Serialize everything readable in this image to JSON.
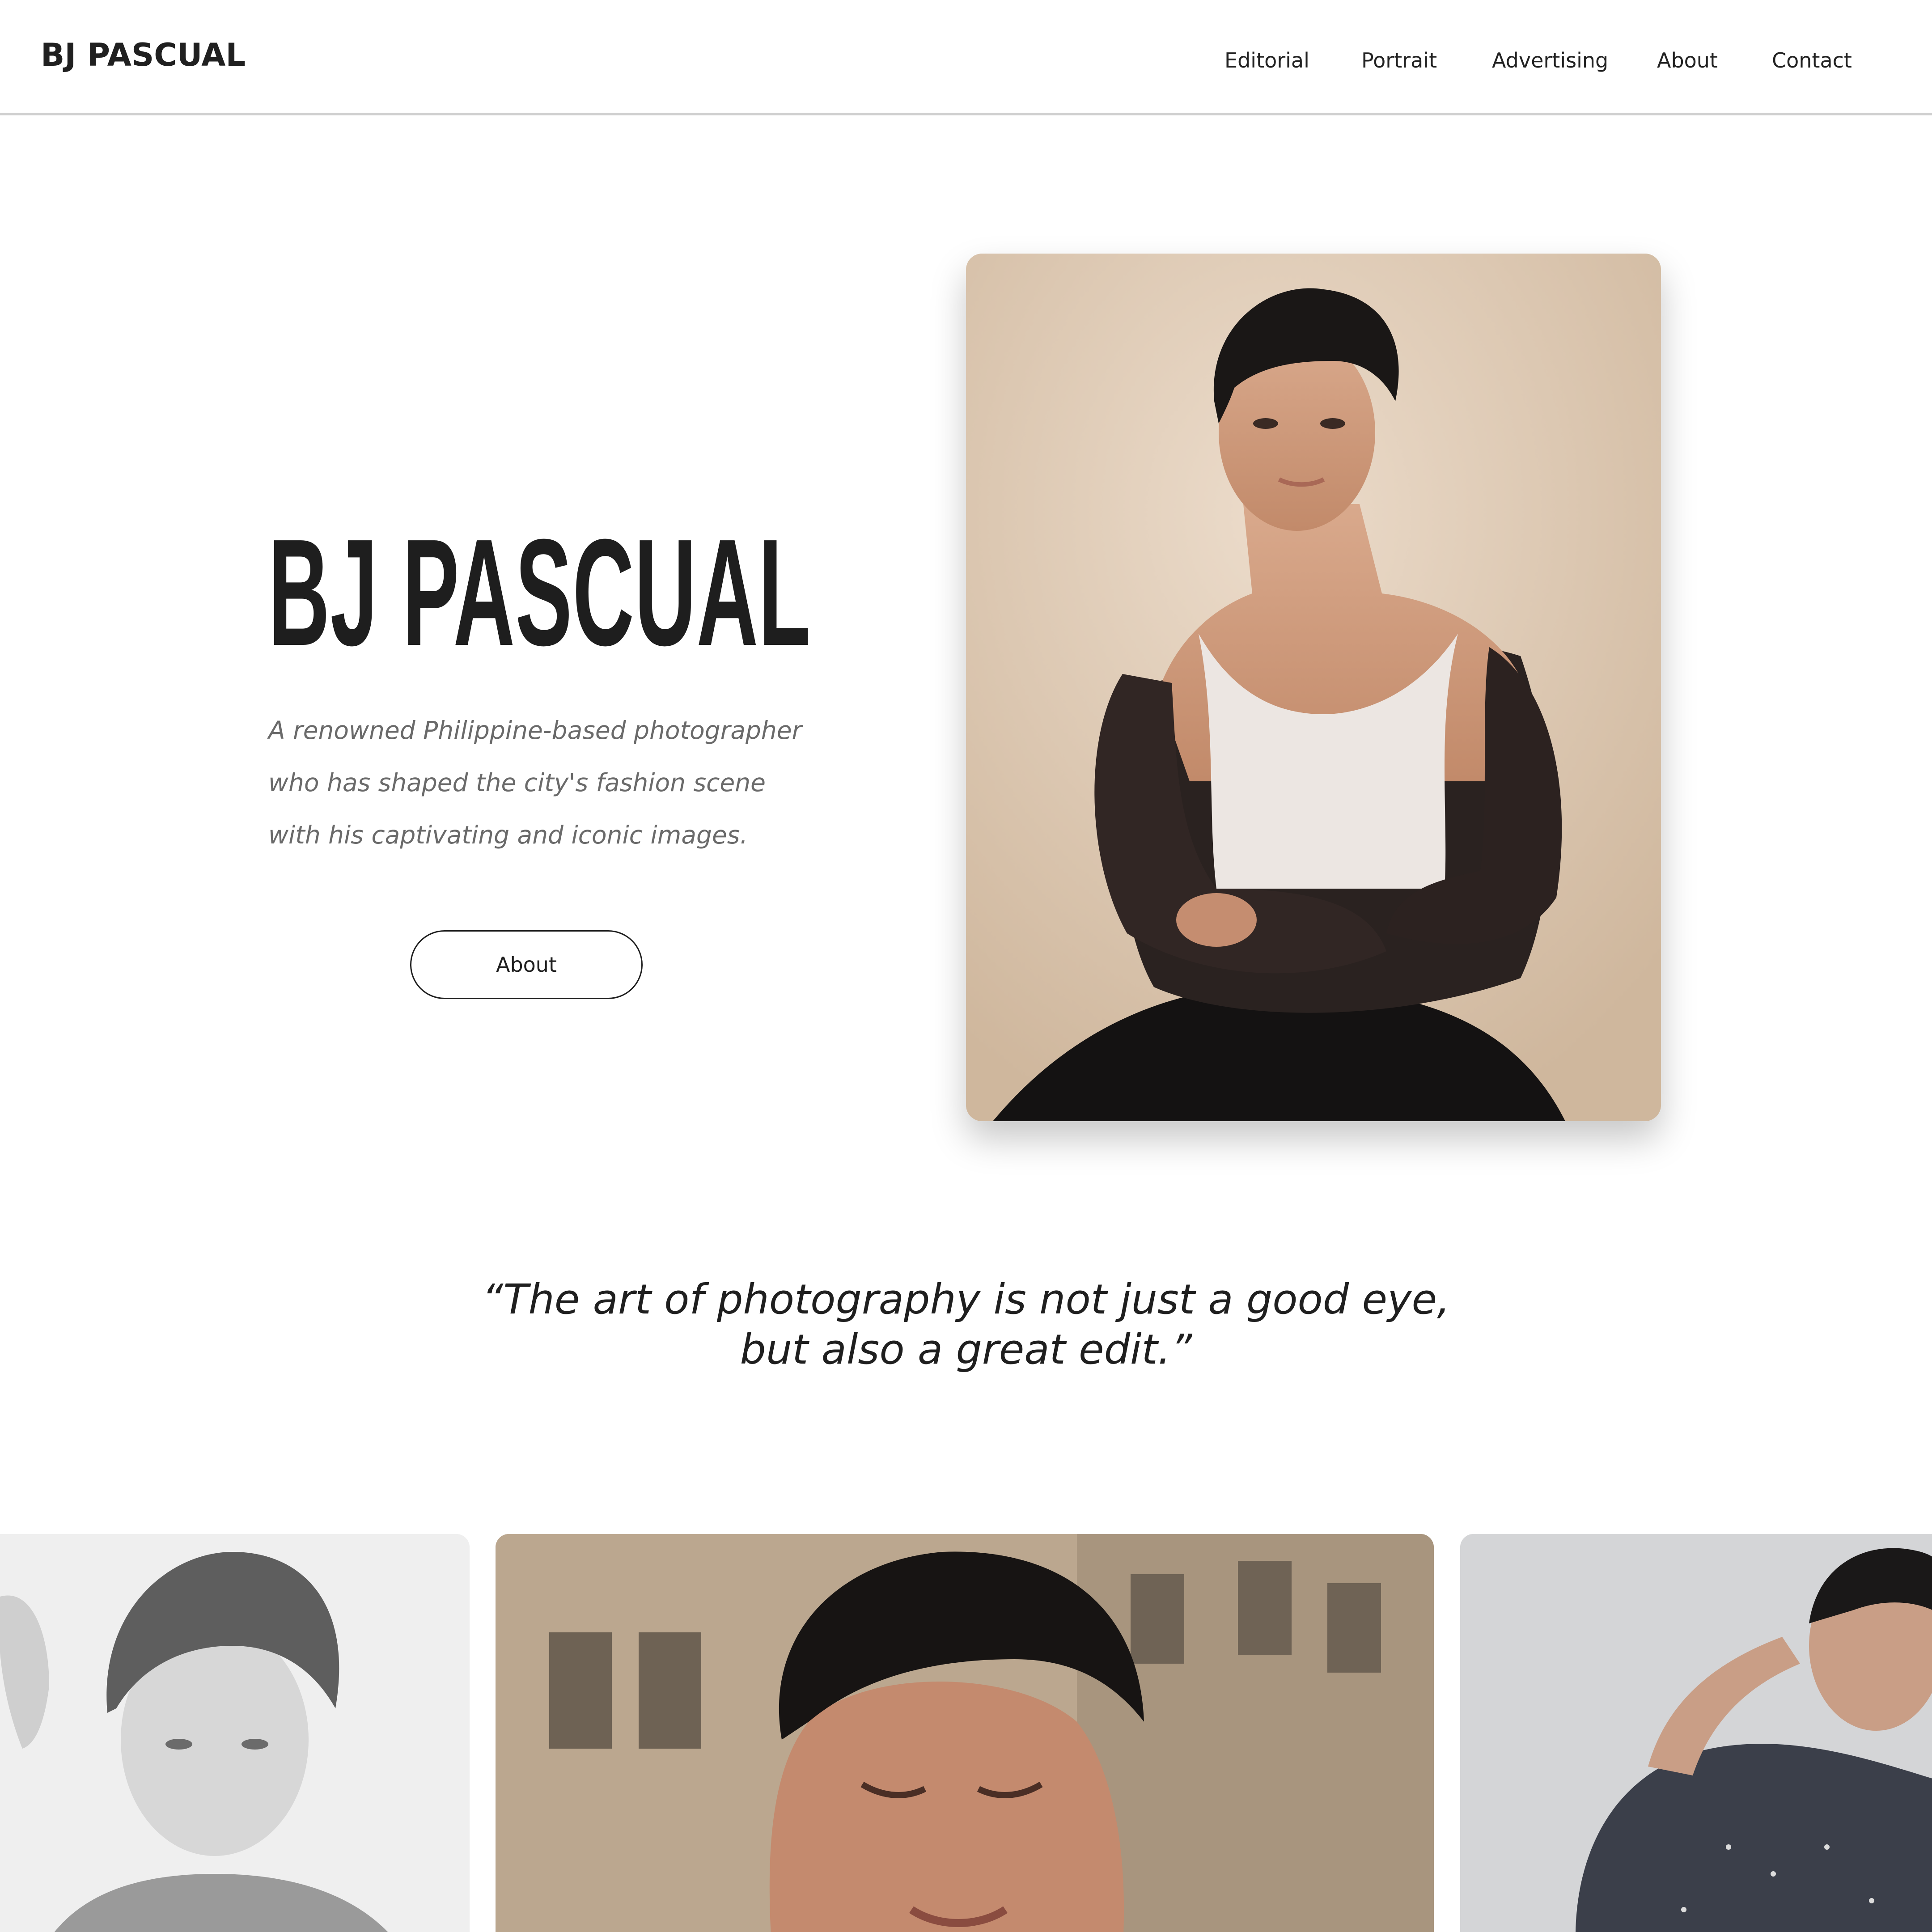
{
  "header": {
    "logo": "BJ PASCUAL",
    "nav": [
      "Editorial",
      "Portrait",
      "Advertising",
      "About",
      "Contact"
    ]
  },
  "hero": {
    "title": "BJ PASCUAL",
    "description_lines": [
      "A renowned Philippine-based photographer",
      "who has shaped the city's fashion scene",
      "with his captivating and iconic images."
    ],
    "button_label": "About"
  },
  "quote": {
    "lines": [
      "“The art of photography is not just a good eye,",
      "but also a great edit.”"
    ]
  },
  "colors": {
    "text": "#1f1f1f",
    "muted": "#6a6a6a",
    "divider": "#cfcfcf",
    "hero_photo_bg": "#e0cdb8"
  }
}
